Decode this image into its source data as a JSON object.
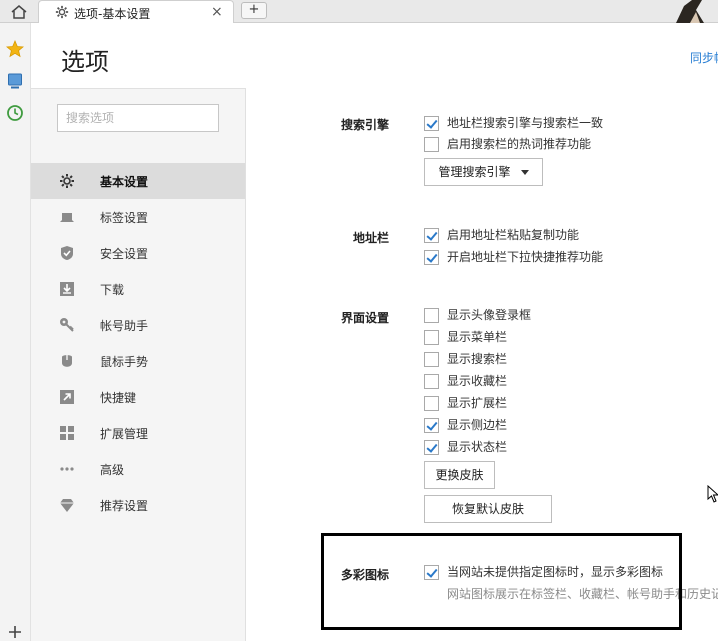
{
  "tab": {
    "title": "选项-基本设置",
    "close": "×",
    "new_tab": "+"
  },
  "page": {
    "title": "选项",
    "sync_link": "同步帐"
  },
  "search": {
    "placeholder": "搜索选项"
  },
  "nav": {
    "items": [
      {
        "label": "基本设置",
        "icon": "gear-icon",
        "active": true
      },
      {
        "label": "标签设置",
        "icon": "tab-icon"
      },
      {
        "label": "安全设置",
        "icon": "shield-check-icon"
      },
      {
        "label": "下载",
        "icon": "download-icon"
      },
      {
        "label": "帐号助手",
        "icon": "key-icon"
      },
      {
        "label": "鼠标手势",
        "icon": "mouse-icon"
      },
      {
        "label": "快捷键",
        "icon": "shortcut-arrow-icon"
      },
      {
        "label": "扩展管理",
        "icon": "extensions-icon"
      },
      {
        "label": "高级",
        "icon": "more-dots-icon"
      },
      {
        "label": "推荐设置",
        "icon": "diamond-icon"
      }
    ]
  },
  "sections": {
    "search_engine": {
      "label": "搜索引擎",
      "options": [
        {
          "label": "地址栏搜索引擎与搜索栏一致",
          "checked": true
        },
        {
          "label": "启用搜索栏的热词推荐功能",
          "checked": false
        }
      ],
      "manage_button": "管理搜索引擎"
    },
    "address_bar": {
      "label": "地址栏",
      "options": [
        {
          "label": "启用地址栏粘贴复制功能",
          "checked": true
        },
        {
          "label": "开启地址栏下拉快捷推荐功能",
          "checked": true
        }
      ]
    },
    "interface": {
      "label": "界面设置",
      "options": [
        {
          "label": "显示头像登录框",
          "checked": false
        },
        {
          "label": "显示菜单栏",
          "checked": false
        },
        {
          "label": "显示搜索栏",
          "checked": false
        },
        {
          "label": "显示收藏栏",
          "checked": false
        },
        {
          "label": "显示扩展栏",
          "checked": false
        },
        {
          "label": "显示侧边栏",
          "checked": true
        },
        {
          "label": "显示状态栏",
          "checked": true
        }
      ],
      "change_skin_button": "更换皮肤",
      "restore_skin_button": "恢复默认皮肤"
    },
    "colorful_icons": {
      "label": "多彩图标",
      "options": [
        {
          "label": "当网站未提供指定图标时，显示多彩图标",
          "checked": true
        }
      ],
      "note": "网站图标展示在标签栏、收藏栏、帐号助手和历史记录"
    }
  },
  "colors": {
    "accent": "#2a79c9",
    "link": "#2a7fd4",
    "nav_bg": "#f5f5f5",
    "nav_active": "#dcdcdc"
  }
}
